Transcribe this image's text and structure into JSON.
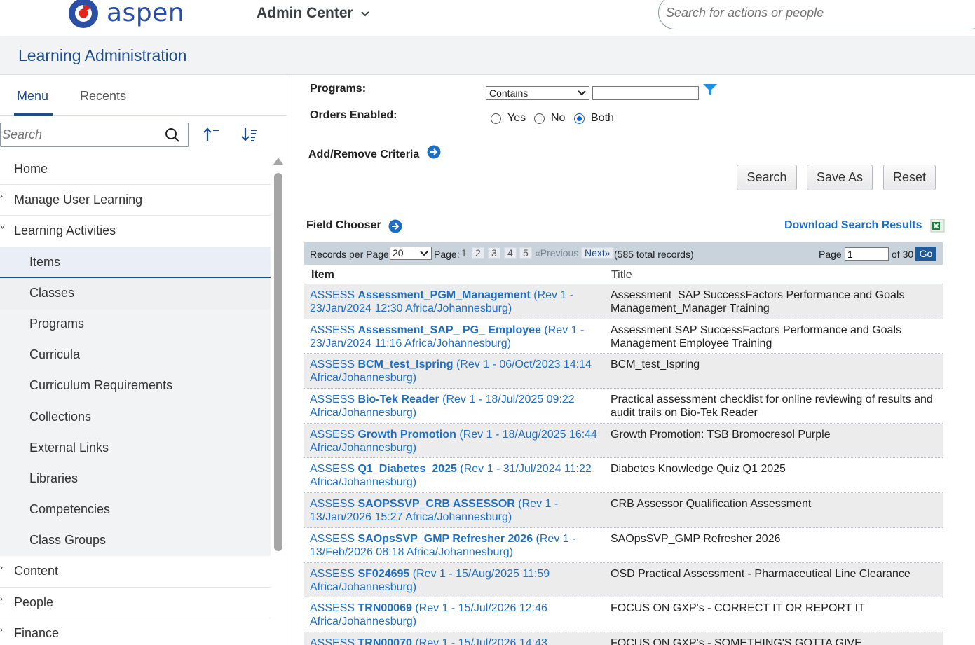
{
  "header": {
    "logo_text": "aspen",
    "admin_center": "Admin Center",
    "global_search_placeholder": "Search for actions or people"
  },
  "section_title": "Learning Administration",
  "sidebar": {
    "tabs": [
      {
        "label": "Menu"
      },
      {
        "label": "Recents"
      }
    ],
    "search_placeholder": "Search",
    "items": [
      {
        "label": "Home"
      },
      {
        "label": "Manage User Learning"
      },
      {
        "label": "Learning Activities"
      },
      {
        "label": "Items"
      },
      {
        "label": "Classes"
      },
      {
        "label": "Programs"
      },
      {
        "label": "Curricula"
      },
      {
        "label": "Curriculum Requirements"
      },
      {
        "label": "Collections"
      },
      {
        "label": "External Links"
      },
      {
        "label": "Libraries"
      },
      {
        "label": "Competencies"
      },
      {
        "label": "Class Groups"
      },
      {
        "label": "Content"
      },
      {
        "label": "People"
      },
      {
        "label": "Finance"
      }
    ]
  },
  "criteria": {
    "programs_label": "Programs:",
    "programs_operator": "Contains",
    "programs_value": "",
    "orders_label": "Orders Enabled:",
    "orders_options": [
      "Yes",
      "No",
      "Both"
    ],
    "orders_selected": "Both",
    "add_remove": "Add/Remove Criteria"
  },
  "buttons": {
    "search": "Search",
    "save_as": "Save As",
    "reset": "Reset"
  },
  "field_chooser": "Field Chooser",
  "download": "Download Search Results",
  "results": {
    "records_per_page_label": "Records per Page",
    "records_per_page": "20",
    "page_label": "Page:",
    "pages": [
      "1",
      "2",
      "3",
      "4",
      "5"
    ],
    "previous": "«Previous",
    "next": "Next»",
    "total": "(585 total records)",
    "page_word": "Page",
    "current_page": "1",
    "of_pages": "of 30",
    "go": "Go"
  },
  "table": {
    "columns": [
      "Item",
      "Title"
    ],
    "rows": [
      {
        "type": "ASSESS",
        "id": "Assessment_PGM_Management",
        "rev": "(Rev 1 - 23/Jan/2024 12:30 Africa/Johannesburg)",
        "title": "Assessment_SAP SuccessFactors Performance and Goals Management_Manager Training"
      },
      {
        "type": "ASSESS",
        "id": "Assessment_SAP_ PG_ Employee",
        "rev": "(Rev 1 - 23/Jan/2024 11:16 Africa/Johannesburg)",
        "title": "Assessment SAP SuccessFactors Performance and Goals Management Employee Training"
      },
      {
        "type": "ASSESS",
        "id": "BCM_test_Ispring",
        "rev": "(Rev 1 - 06/Oct/2023 14:14 Africa/Johannesburg)",
        "title": "BCM_test_Ispring"
      },
      {
        "type": "ASSESS",
        "id": "Bio-Tek Reader",
        "rev": "(Rev 1 - 18/Jul/2025 09:22 Africa/Johannesburg)",
        "title": "Practical assessment checklist for online reviewing of results and audit trails on Bio-Tek Reader"
      },
      {
        "type": "ASSESS",
        "id": "Growth Promotion",
        "rev": "(Rev 1 - 18/Aug/2025 16:44 Africa/Johannesburg)",
        "title": "Growth Promotion: TSB Bromocresol Purple"
      },
      {
        "type": "ASSESS",
        "id": "Q1_Diabetes_2025",
        "rev": "(Rev 1 - 31/Jul/2024 11:22 Africa/Johannesburg)",
        "title": "Diabetes Knowledge Quiz Q1 2025"
      },
      {
        "type": "ASSESS",
        "id": "SAOPSSVP_CRB ASSESSOR",
        "rev": "(Rev 1 - 13/Jan/2026 15:27 Africa/Johannesburg)",
        "title": "CRB Assessor Qualification Assessment"
      },
      {
        "type": "ASSESS",
        "id": "SAOpsSVP_GMP Refresher 2026",
        "rev": "(Rev 1 - 13/Feb/2026 08:18 Africa/Johannesburg)",
        "title": "SAOpsSVP_GMP Refresher 2026"
      },
      {
        "type": "ASSESS",
        "id": "SF024695",
        "rev": "(Rev 1 - 15/Aug/2025 11:59 Africa/Johannesburg)",
        "title": "OSD Practical Assessment - Pharmaceutical Line Clearance"
      },
      {
        "type": "ASSESS",
        "id": "TRN00069",
        "rev": "(Rev 1 - 15/Jul/2026 12:46 Africa/Johannesburg)",
        "title": "FOCUS ON GXP's - CORRECT IT OR REPORT IT"
      },
      {
        "type": "ASSESS",
        "id": "TRN00070",
        "rev": "(Rev 1 - 15/Jul/2026 14:43",
        "title": "FOCUS ON GXP's - SOMETHING'S GOTTA GIVE"
      }
    ]
  },
  "colors": {
    "brand_blue": "#1f4d8c",
    "link_blue": "#1f6fc1",
    "accent_red": "#e2231a"
  }
}
